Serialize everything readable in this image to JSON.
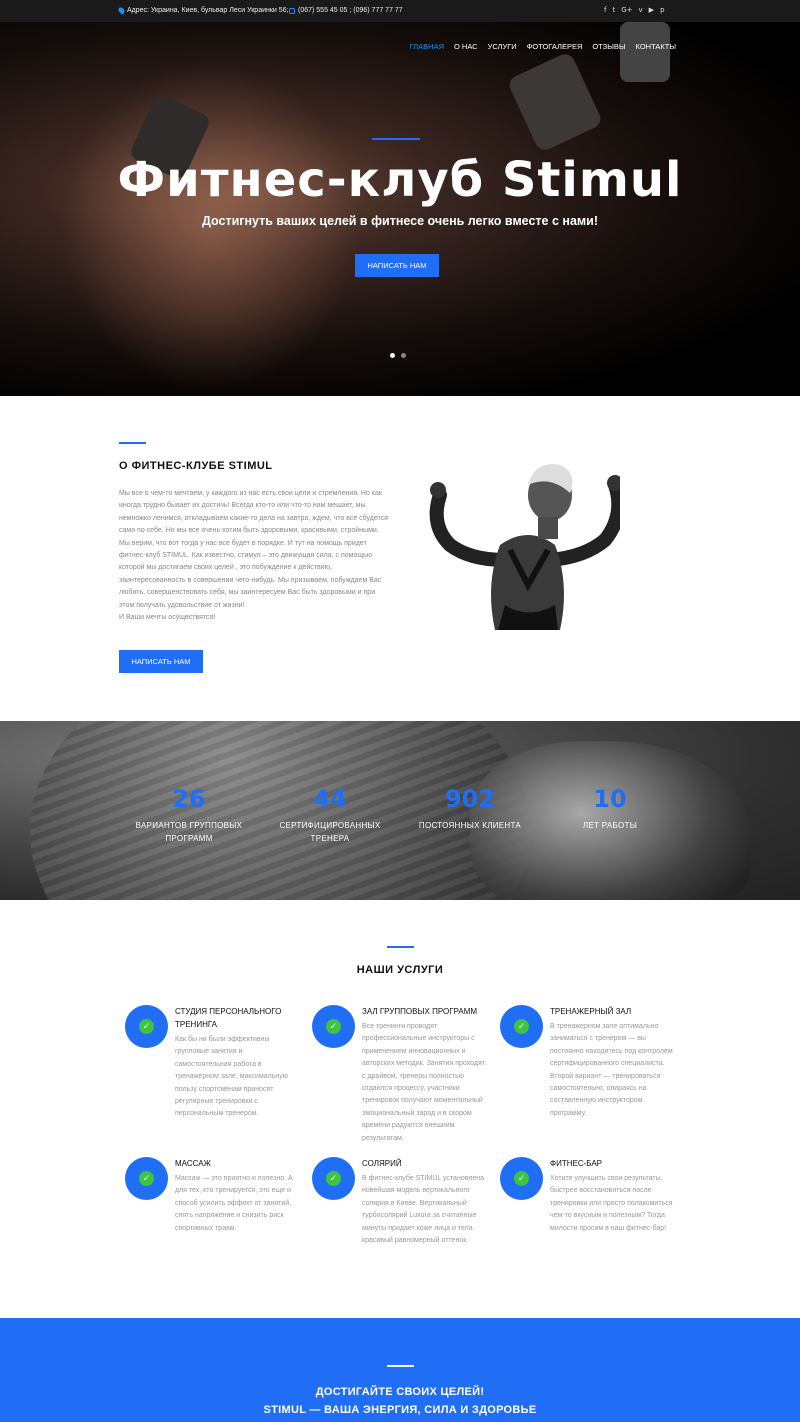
{
  "topbar": {
    "address": "Адрес:  Украина, Киев, бульвар Леси Украинки 56;",
    "phones": "(067) 555 45 05 ; (096) 777 77 77",
    "social": [
      "f",
      "t",
      "G+",
      "v",
      "▶",
      "p"
    ]
  },
  "nav": [
    "ГЛАВНАЯ",
    "О НАС",
    "УСЛУГИ",
    "ФОТОГАЛЕРЕЯ",
    "ОТЗЫВЫ",
    "КОНТАКТЫ"
  ],
  "hero": {
    "title": "Фитнес-клуб Stimul",
    "subtitle": "Достигнуть ваших целей в фитнесе очень легко вместе с нами!",
    "button": "НАПИСАТЬ НАМ"
  },
  "about": {
    "title": "О ФИТНЕС-КЛУБЕ STIMUL",
    "text": "Мы все о чем-то мечтаем, у каждого из нас есть свои цели и стремления. Но как иногда трудно бывает их достичь! Всегда кто-то или что-то нам мешает, мы немножко ленимся, откладываем какие-то дела на завтра, ждем, что все сбудется само по себе. Но мы все очень хотим быть здоровыми, красивыми, стройными. Мы верим, что вот тогда у нас все будет в порядке. И тут на помощь придет фитнес-клуб STIMUL. Как известно, стимул – это движущая сила, с помощью которой мы достигаем своих целей , это побуждение к действию, заинтересованность в совершении чего-нибудь. Мы призываем, побуждаем Вас любить, совершенствовать себя, мы заинтересуем Вас быть здоровыми и при этом получать удовольствие от жизни!",
    "text2": "И Ваши мечты осуществятся!",
    "button": "НАПИСАТЬ НАМ"
  },
  "stats": [
    {
      "num": "26",
      "label": "ВАРИАНТОВ ГРУППОВЫХ ПРОГРАММ"
    },
    {
      "num": "44",
      "label": "СЕРТИФИЦИРОВАННЫХ ТРЕНЕРА"
    },
    {
      "num": "902",
      "label": "ПОСТОЯННЫХ КЛИЕНТА"
    },
    {
      "num": "10",
      "label": "ЛЕТ РАБОТЫ"
    }
  ],
  "services": {
    "title": "НАШИ УСЛУГИ",
    "items": [
      {
        "title": "СТУДИЯ ПЕРСОНАЛЬНОГО ТРЕНИНГА",
        "desc": "Как бы ни были эффективны групповые занятия и самостоятельная работа в тренажерном зале, максимальную пользу спортсменам приносят регулярные тренировки с персональным тренером."
      },
      {
        "title": "ЗАЛ ГРУППОВЫХ ПРОГРАММ",
        "desc": "Все тренинги проводят профессиональные инструкторы с применением инновационных и авторских методик. Занятия проходят с драйвом, тренеры полностью отдаются процессу, участники тренировок получают моментальный эмоциональный заряд и в скором времени радуются внешним результатам."
      },
      {
        "title": "ТРЕНАЖЕРНЫЙ ЗАЛ",
        "desc": "В тренажерном зале оптимально заниматься с тренером — вы постоянно находитесь под контролем сертифицированного специалиста. Второй вариант — тренироваться самостоятельно, опираясь на составленную инструктором программу."
      },
      {
        "title": "МАССАЖ",
        "desc": "Массаж — это приятно и полезно. А для тех, кто тренируется, это еще и способ усилить эффект от занятий, снять напряжение и снизить риск спортивных травм."
      },
      {
        "title": "СОЛЯРИЙ",
        "desc": "В фитнес-клубе STIMUL установлена новейшая модель вертикального солярия в Киеве. Вертикальный турбосолярий Luxura за считанные минуты придает коже лица и тела красивый равномерный оттенок."
      },
      {
        "title": "ФИТНЕС-БАР",
        "desc": "Хотите улучшить свои результаты, быстрее восстановиться после тренировки или просто полакомиться чем-то вкусным и полезным? Тогда милости просим в наш фитнес-бар!"
      }
    ]
  },
  "band": {
    "line1": "ДОСТИГАЙТЕ СВОИХ ЦЕЛЕЙ!",
    "line2": "STIMUL — ВАША ЭНЕРГИЯ, СИЛА И ЗДОРОВЬЕ"
  },
  "colors": {
    "accent": "#1f6ef5",
    "check": "#3ec43e",
    "topbar": "#1a1a1a"
  }
}
